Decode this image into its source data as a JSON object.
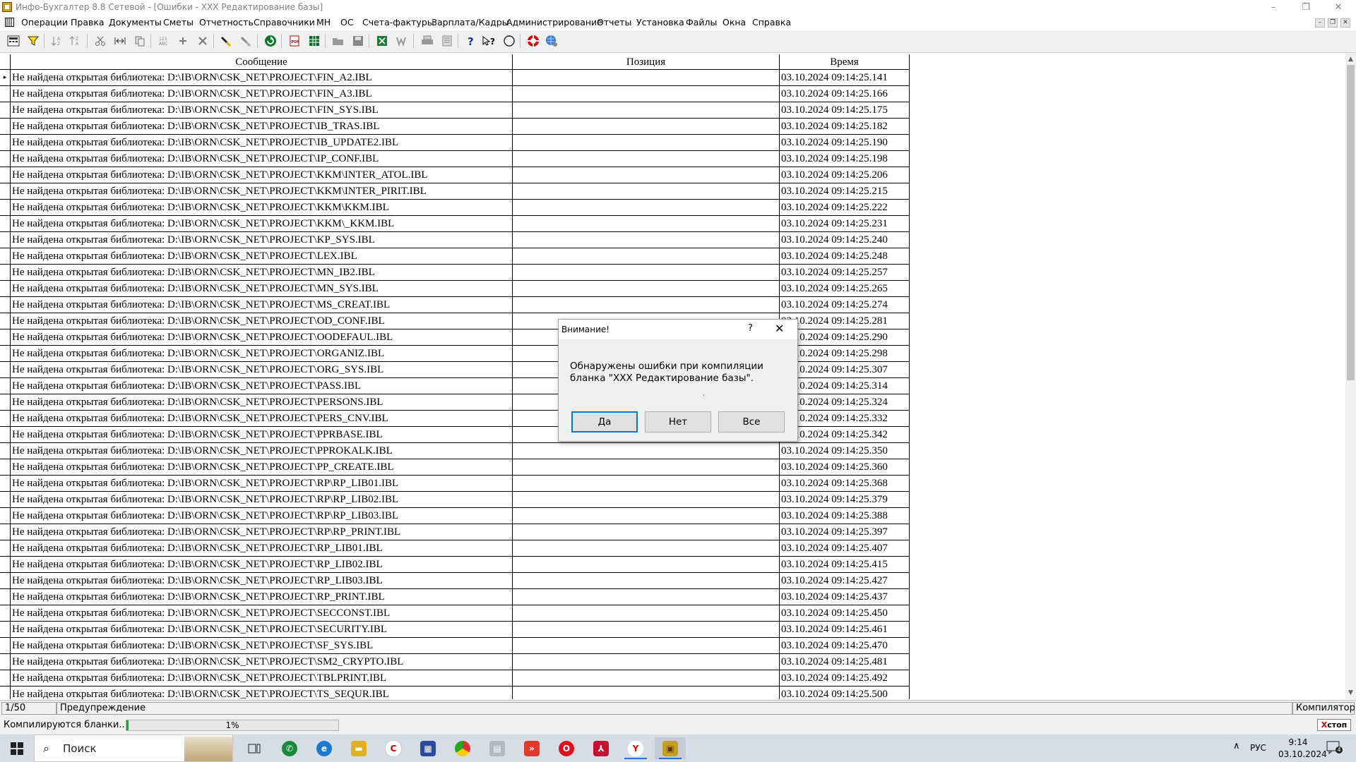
{
  "window": {
    "title": "Инфо-Бухгалтер 8.8 Сетевой - [Ошибки - ХХХ Редактирование базы]",
    "controls": [
      "–",
      "❐",
      "✕"
    ]
  },
  "menu": [
    "Операции",
    "Правка",
    "Документы",
    "Сметы",
    "Отчетность",
    "Справочники",
    "МН",
    "ОС",
    "Счета-фактуры",
    "Зарплата/Кадры",
    "Администрирование",
    "Отчеты",
    "Установка",
    "Файлы",
    "Окна",
    "Справка"
  ],
  "mdi_controls": [
    "–",
    "❐",
    "✕"
  ],
  "toolbar_icons": [
    "calculator-icon",
    "filter-icon",
    "sort-asc-icon",
    "sort-desc-icon",
    "cut-icon",
    "split-icon",
    "copy-icon",
    "number-icon",
    "add-icon",
    "delete-icon",
    "marker-icon",
    "marker-clear-icon",
    "refresh-icon",
    "pdf-icon",
    "spreadsheet-icon",
    "open-icon",
    "save-icon",
    "excel-icon",
    "word-icon",
    "print-icon",
    "preview-icon",
    "help-icon",
    "context-help-icon",
    "compass-icon",
    "lifebuoy-icon",
    "globe-icon"
  ],
  "grid": {
    "columns": [
      "Сообщение",
      "Позиция",
      "Время"
    ],
    "rows": [
      {
        "msg": "Не найдена открытая библиотека: D:\\IB\\ORN\\CSK_NET\\PROJECT\\FIN_A2.IBL",
        "pos": "",
        "time": "03.10.2024 09:14:25.141"
      },
      {
        "msg": "Не найдена открытая библиотека: D:\\IB\\ORN\\CSK_NET\\PROJECT\\FIN_A3.IBL",
        "pos": "",
        "time": "03.10.2024 09:14:25.166"
      },
      {
        "msg": "Не найдена открытая библиотека: D:\\IB\\ORN\\CSK_NET\\PROJECT\\FIN_SYS.IBL",
        "pos": "",
        "time": "03.10.2024 09:14:25.175"
      },
      {
        "msg": "Не найдена открытая библиотека: D:\\IB\\ORN\\CSK_NET\\PROJECT\\IB_TRAS.IBL",
        "pos": "",
        "time": "03.10.2024 09:14:25.182"
      },
      {
        "msg": "Не найдена открытая библиотека: D:\\IB\\ORN\\CSK_NET\\PROJECT\\IB_UPDATE2.IBL",
        "pos": "",
        "time": "03.10.2024 09:14:25.190"
      },
      {
        "msg": "Не найдена открытая библиотека: D:\\IB\\ORN\\CSK_NET\\PROJECT\\IP_CONF.IBL",
        "pos": "",
        "time": "03.10.2024 09:14:25.198"
      },
      {
        "msg": "Не найдена открытая библиотека: D:\\IB\\ORN\\CSK_NET\\PROJECT\\KKM\\INTER_ATOL.IBL",
        "pos": "",
        "time": "03.10.2024 09:14:25.206"
      },
      {
        "msg": "Не найдена открытая библиотека: D:\\IB\\ORN\\CSK_NET\\PROJECT\\KKM\\INTER_PIRIT.IBL",
        "pos": "",
        "time": "03.10.2024 09:14:25.215"
      },
      {
        "msg": "Не найдена открытая библиотека: D:\\IB\\ORN\\CSK_NET\\PROJECT\\KKM\\KKM.IBL",
        "pos": "",
        "time": "03.10.2024 09:14:25.222"
      },
      {
        "msg": "Не найдена открытая библиотека: D:\\IB\\ORN\\CSK_NET\\PROJECT\\KKM\\_KKM.IBL",
        "pos": "",
        "time": "03.10.2024 09:14:25.231"
      },
      {
        "msg": "Не найдена открытая библиотека: D:\\IB\\ORN\\CSK_NET\\PROJECT\\KP_SYS.IBL",
        "pos": "",
        "time": "03.10.2024 09:14:25.240"
      },
      {
        "msg": "Не найдена открытая библиотека: D:\\IB\\ORN\\CSK_NET\\PROJECT\\LEX.IBL",
        "pos": "",
        "time": "03.10.2024 09:14:25.248"
      },
      {
        "msg": "Не найдена открытая библиотека: D:\\IB\\ORN\\CSK_NET\\PROJECT\\MN_IB2.IBL",
        "pos": "",
        "time": "03.10.2024 09:14:25.257"
      },
      {
        "msg": "Не найдена открытая библиотека: D:\\IB\\ORN\\CSK_NET\\PROJECT\\MN_SYS.IBL",
        "pos": "",
        "time": "03.10.2024 09:14:25.265"
      },
      {
        "msg": "Не найдена открытая библиотека: D:\\IB\\ORN\\CSK_NET\\PROJECT\\MS_CREAT.IBL",
        "pos": "",
        "time": "03.10.2024 09:14:25.274"
      },
      {
        "msg": "Не найдена открытая библиотека: D:\\IB\\ORN\\CSK_NET\\PROJECT\\OD_CONF.IBL",
        "pos": "",
        "time": "03.10.2024 09:14:25.281"
      },
      {
        "msg": "Не найдена открытая библиотека: D:\\IB\\ORN\\CSK_NET\\PROJECT\\OODEFAUL.IBL",
        "pos": "",
        "time": "03.10.2024 09:14:25.290"
      },
      {
        "msg": "Не найдена открытая библиотека: D:\\IB\\ORN\\CSK_NET\\PROJECT\\ORGANIZ.IBL",
        "pos": "",
        "time": "03.10.2024 09:14:25.298"
      },
      {
        "msg": "Не найдена открытая библиотека: D:\\IB\\ORN\\CSK_NET\\PROJECT\\ORG_SYS.IBL",
        "pos": "",
        "time": "03.10.2024 09:14:25.307"
      },
      {
        "msg": "Не найдена открытая библиотека: D:\\IB\\ORN\\CSK_NET\\PROJECT\\PASS.IBL",
        "pos": "",
        "time": "03.10.2024 09:14:25.314"
      },
      {
        "msg": "Не найдена открытая библиотека: D:\\IB\\ORN\\CSK_NET\\PROJECT\\PERSONS.IBL",
        "pos": "",
        "time": "03.10.2024 09:14:25.324"
      },
      {
        "msg": "Не найдена открытая библиотека: D:\\IB\\ORN\\CSK_NET\\PROJECT\\PERS_CNV.IBL",
        "pos": "",
        "time": "03.10.2024 09:14:25.332"
      },
      {
        "msg": "Не найдена открытая библиотека: D:\\IB\\ORN\\CSK_NET\\PROJECT\\PPRBASE.IBL",
        "pos": "",
        "time": "03.10.2024 09:14:25.342"
      },
      {
        "msg": "Не найдена открытая библиотека: D:\\IB\\ORN\\CSK_NET\\PROJECT\\PPROKALK.IBL",
        "pos": "",
        "time": "03.10.2024 09:14:25.350"
      },
      {
        "msg": "Не найдена открытая библиотека: D:\\IB\\ORN\\CSK_NET\\PROJECT\\PP_CREATE.IBL",
        "pos": "",
        "time": "03.10.2024 09:14:25.360"
      },
      {
        "msg": "Не найдена открытая библиотека: D:\\IB\\ORN\\CSK_NET\\PROJECT\\RP\\RP_LIB01.IBL",
        "pos": "",
        "time": "03.10.2024 09:14:25.368"
      },
      {
        "msg": "Не найдена открытая библиотека: D:\\IB\\ORN\\CSK_NET\\PROJECT\\RP\\RP_LIB02.IBL",
        "pos": "",
        "time": "03.10.2024 09:14:25.379"
      },
      {
        "msg": "Не найдена открытая библиотека: D:\\IB\\ORN\\CSK_NET\\PROJECT\\RP\\RP_LIB03.IBL",
        "pos": "",
        "time": "03.10.2024 09:14:25.388"
      },
      {
        "msg": "Не найдена открытая библиотека: D:\\IB\\ORN\\CSK_NET\\PROJECT\\RP\\RP_PRINT.IBL",
        "pos": "",
        "time": "03.10.2024 09:14:25.397"
      },
      {
        "msg": "Не найдена открытая библиотека: D:\\IB\\ORN\\CSK_NET\\PROJECT\\RP_LIB01.IBL",
        "pos": "",
        "time": "03.10.2024 09:14:25.407"
      },
      {
        "msg": "Не найдена открытая библиотека: D:\\IB\\ORN\\CSK_NET\\PROJECT\\RP_LIB02.IBL",
        "pos": "",
        "time": "03.10.2024 09:14:25.415"
      },
      {
        "msg": "Не найдена открытая библиотека: D:\\IB\\ORN\\CSK_NET\\PROJECT\\RP_LIB03.IBL",
        "pos": "",
        "time": "03.10.2024 09:14:25.427"
      },
      {
        "msg": "Не найдена открытая библиотека: D:\\IB\\ORN\\CSK_NET\\PROJECT\\RP_PRINT.IBL",
        "pos": "",
        "time": "03.10.2024 09:14:25.437"
      },
      {
        "msg": "Не найдена открытая библиотека: D:\\IB\\ORN\\CSK_NET\\PROJECT\\SECCONST.IBL",
        "pos": "",
        "time": "03.10.2024 09:14:25.450"
      },
      {
        "msg": "Не найдена открытая библиотека: D:\\IB\\ORN\\CSK_NET\\PROJECT\\SECURITY.IBL",
        "pos": "",
        "time": "03.10.2024 09:14:25.461"
      },
      {
        "msg": "Не найдена открытая библиотека: D:\\IB\\ORN\\CSK_NET\\PROJECT\\SF_SYS.IBL",
        "pos": "",
        "time": "03.10.2024 09:14:25.470"
      },
      {
        "msg": "Не найдена открытая библиотека: D:\\IB\\ORN\\CSK_NET\\PROJECT\\SM2_CRYPTO.IBL",
        "pos": "",
        "time": "03.10.2024 09:14:25.481"
      },
      {
        "msg": "Не найдена открытая библиотека: D:\\IB\\ORN\\CSK_NET\\PROJECT\\TBLPRINT.IBL",
        "pos": "",
        "time": "03.10.2024 09:14:25.492"
      },
      {
        "msg": "Не найдена открытая библиотека: D:\\IB\\ORN\\CSK_NET\\PROJECT\\TS_SEQUR.IBL",
        "pos": "",
        "time": "03.10.2024 09:14:25.500"
      }
    ],
    "current_row_marker": "▸"
  },
  "status_bar": {
    "count": "1/50",
    "type": "Предупреждение",
    "source": "Компилятор"
  },
  "progress": {
    "label": "Компилируются бланки...",
    "percent_text": "1%",
    "fraction": 0.01,
    "stop_x": "X",
    "stop_label": "стоп"
  },
  "dialog": {
    "title": "Внимание!",
    "help": "?",
    "close": "✕",
    "message": "Обнаружены ошибки при компиляции бланка \"ХХХ Редактирование базы\".",
    "dot": ".",
    "buttons": {
      "yes": "Да",
      "no": "Нет",
      "all": "Все"
    }
  },
  "taskbar": {
    "search_placeholder": "Поиск",
    "apps": [
      "task-view-icon",
      "whatsapp-icon",
      "edge-icon",
      "file-explorer-icon",
      "ccleaner-icon",
      "app-icon",
      "chrome-icon",
      "printer-app-icon",
      "anydesk-icon",
      "opera-icon",
      "pdf-reader-icon",
      "yandex-browser-icon",
      "info-buhgalter-icon"
    ],
    "tray": {
      "chevron": "∧",
      "lang": "РУС",
      "time": "9:14",
      "date": "03.10.2024",
      "notifications": "4"
    }
  },
  "colors": {
    "progress_fill": "#06b025",
    "dialog_default_border": "#0078d7",
    "stop_x": "#d00000"
  }
}
